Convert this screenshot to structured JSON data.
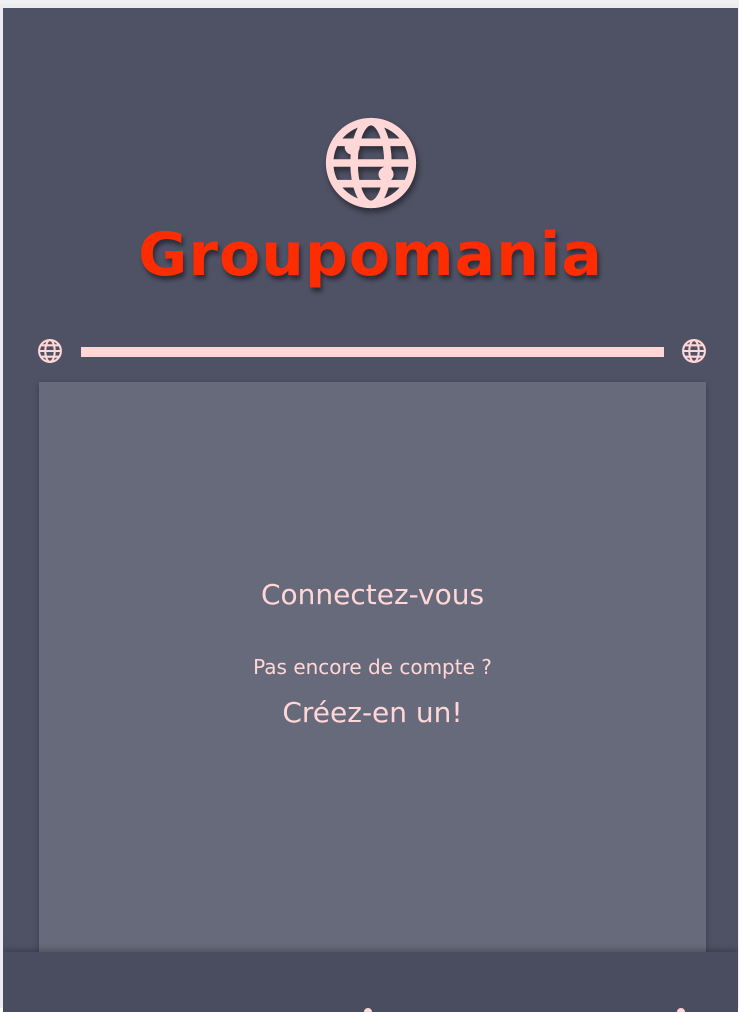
{
  "brand": {
    "name": "Groupomania",
    "logo_icon": "globe-icon",
    "brand_color": "#fd2d01",
    "accent_color": "#ffd7d7"
  },
  "divider": {
    "left_icon": "globe-icon",
    "right_icon": "globe-icon"
  },
  "auth": {
    "login_label": "Connectez-vous",
    "no_account_text": "Pas encore de compte ?",
    "signup_label": "Créez-en un!"
  },
  "colors": {
    "background": "#4f5165",
    "card": "#676a7a",
    "footer": "#4a4c60"
  }
}
